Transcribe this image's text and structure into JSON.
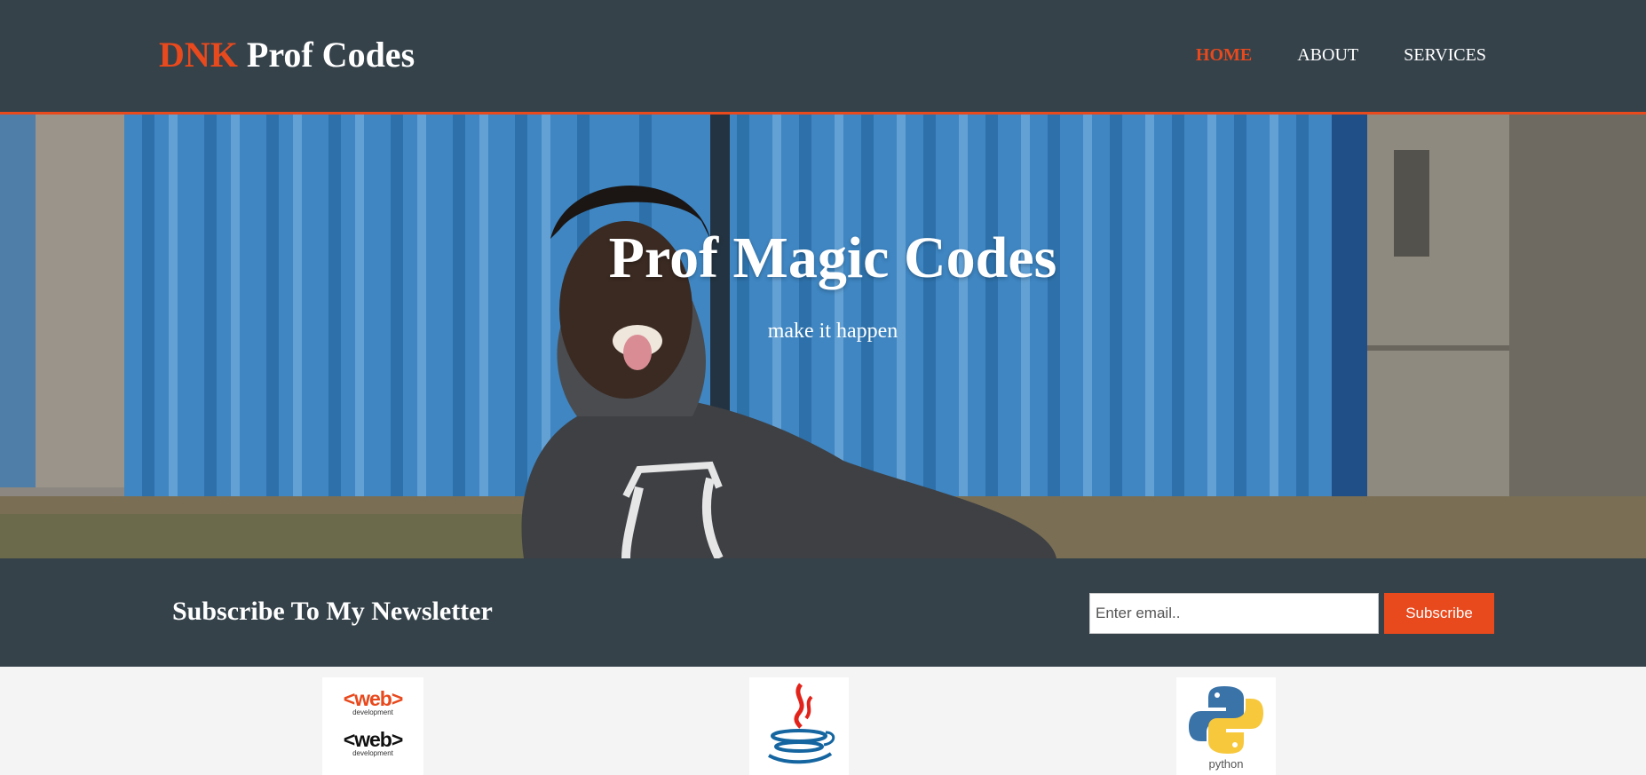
{
  "header": {
    "brand_highlight": "DNK",
    "brand_rest": " Prof Codes",
    "nav": [
      {
        "label": "HOME",
        "current": true
      },
      {
        "label": "ABOUT",
        "current": false
      },
      {
        "label": "SERVICES",
        "current": false
      }
    ]
  },
  "showcase": {
    "title": "Prof Magic Codes",
    "subtitle": "make it happen"
  },
  "newsletter": {
    "heading": "Subscribe To My Newsletter",
    "email_placeholder": "Enter email..",
    "subscribe_label": "Subscribe"
  },
  "boxes": {
    "web": {
      "word_1": "<web>",
      "caption_1": "development",
      "word_2": "<web>",
      "caption_2": "development"
    },
    "java": {
      "icon": "java-logo-icon"
    },
    "python": {
      "label": "python"
    }
  },
  "colors": {
    "accent": "#e8491d",
    "header_bg": "#35424a",
    "page_bg": "#f4f4f4"
  }
}
